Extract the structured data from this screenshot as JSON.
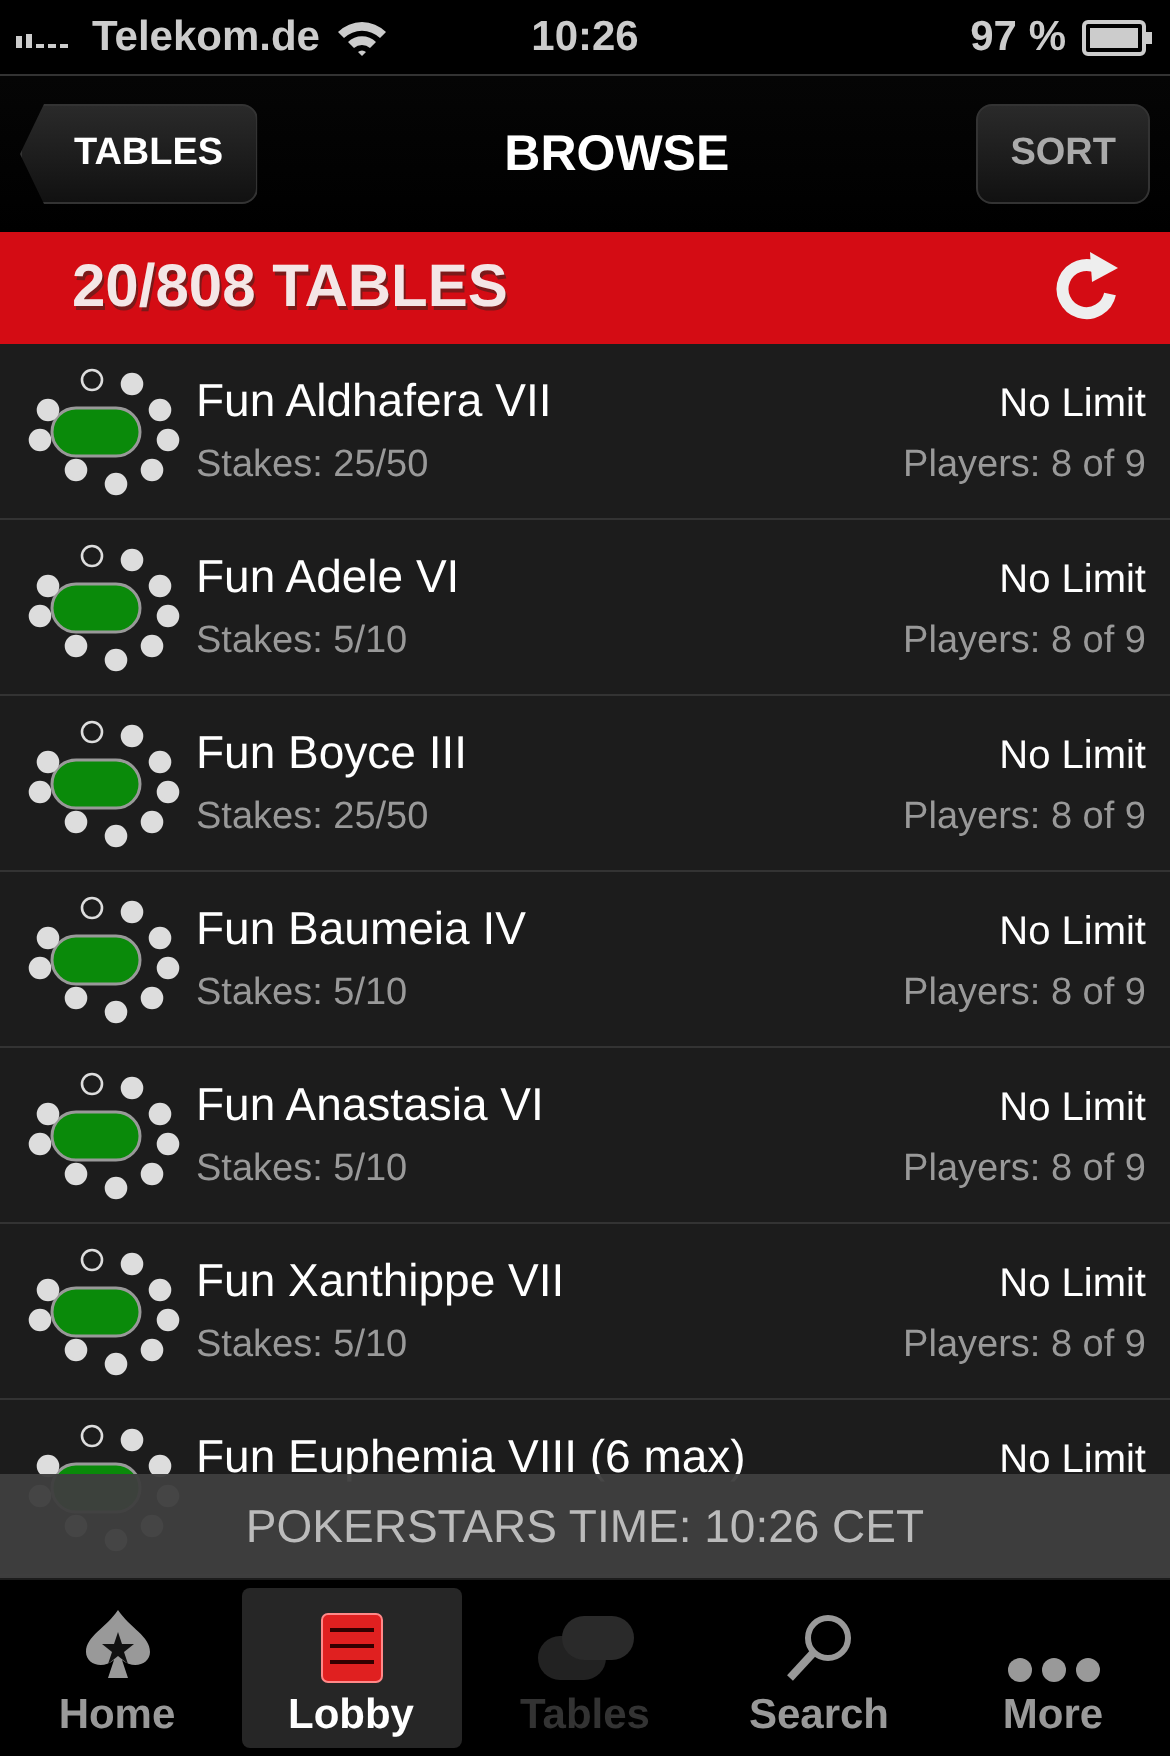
{
  "status_bar": {
    "carrier": "Telekom.de",
    "time": "10:26",
    "battery": "97 %"
  },
  "nav": {
    "back": "TABLES",
    "title": "BROWSE",
    "action": "SORT"
  },
  "header": {
    "title": "20/808 TABLES"
  },
  "rows": [
    {
      "name": "Fun Aldhafera VII",
      "stakes": "Stakes: 25/50",
      "limit": "No Limit",
      "players": "Players: 8 of 9"
    },
    {
      "name": "Fun Adele VI",
      "stakes": "Stakes: 5/10",
      "limit": "No Limit",
      "players": "Players: 8 of 9"
    },
    {
      "name": "Fun Boyce III",
      "stakes": "Stakes: 25/50",
      "limit": "No Limit",
      "players": "Players: 8 of 9"
    },
    {
      "name": "Fun Baumeia IV",
      "stakes": "Stakes: 5/10",
      "limit": "No Limit",
      "players": "Players: 8 of 9"
    },
    {
      "name": "Fun Anastasia VI",
      "stakes": "Stakes: 5/10",
      "limit": "No Limit",
      "players": "Players: 8 of 9"
    },
    {
      "name": "Fun Xanthippe VII",
      "stakes": "Stakes: 5/10",
      "limit": "No Limit",
      "players": "Players: 8 of 9"
    },
    {
      "name": "Fun Euphemia VIII (6 max)",
      "limit": "No Limit"
    }
  ],
  "time_banner": "POKERSTARS TIME: 10:26 CET",
  "tabs": [
    {
      "label": "Home",
      "kind": "home",
      "selected": false,
      "disabled": false
    },
    {
      "label": "Lobby",
      "kind": "lobby",
      "selected": true,
      "disabled": false
    },
    {
      "label": "Tables",
      "kind": "tables",
      "selected": false,
      "disabled": true
    },
    {
      "label": "Search",
      "kind": "search",
      "selected": false,
      "disabled": false
    },
    {
      "label": "More",
      "kind": "more",
      "selected": false,
      "disabled": false
    }
  ]
}
